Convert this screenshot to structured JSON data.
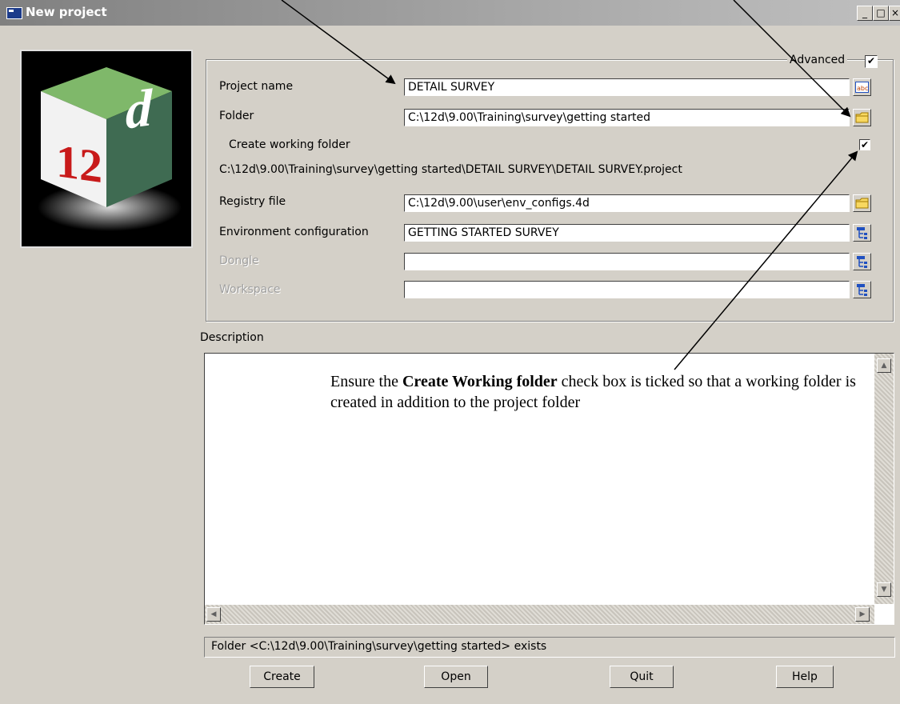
{
  "window": {
    "title": "New project",
    "controls": {
      "minimize": "_",
      "maximize": "□",
      "close": "×"
    }
  },
  "logo": {
    "text_left": "12",
    "text_right": "d"
  },
  "advanced": {
    "label": "Advanced",
    "checked": true
  },
  "form": {
    "project_name": {
      "label": "Project name",
      "value": "DETAIL SURVEY"
    },
    "folder": {
      "label": "Folder",
      "value": "C:\\12d\\9.00\\Training\\survey\\getting started"
    },
    "create_working_folder": {
      "label": "Create working folder",
      "checked": true
    },
    "project_path": "C:\\12d\\9.00\\Training\\survey\\getting started\\DETAIL SURVEY\\DETAIL SURVEY.project",
    "registry_file": {
      "label": "Registry file",
      "value": "C:\\12d\\9.00\\user\\env_configs.4d"
    },
    "environment_configuration": {
      "label": "Environment configuration",
      "value": "GETTING STARTED SURVEY"
    },
    "dongle": {
      "label": "Dongle",
      "value": ""
    },
    "workspace": {
      "label": "Workspace",
      "value": ""
    }
  },
  "description": {
    "label": "Description",
    "annotation_prefix": "Ensure the ",
    "annotation_bold": "Create Working folder",
    "annotation_suffix": " check box is ticked so that a working folder is created in addition to the project folder"
  },
  "status_text": "Folder <C:\\12d\\9.00\\Training\\survey\\getting started> exists",
  "buttons": {
    "create": "Create",
    "open": "Open",
    "quit": "Quit",
    "help": "Help"
  },
  "icons": {
    "text_picker": "abc-icon",
    "folder": "folder-icon",
    "tree_picker": "tree-icon"
  }
}
